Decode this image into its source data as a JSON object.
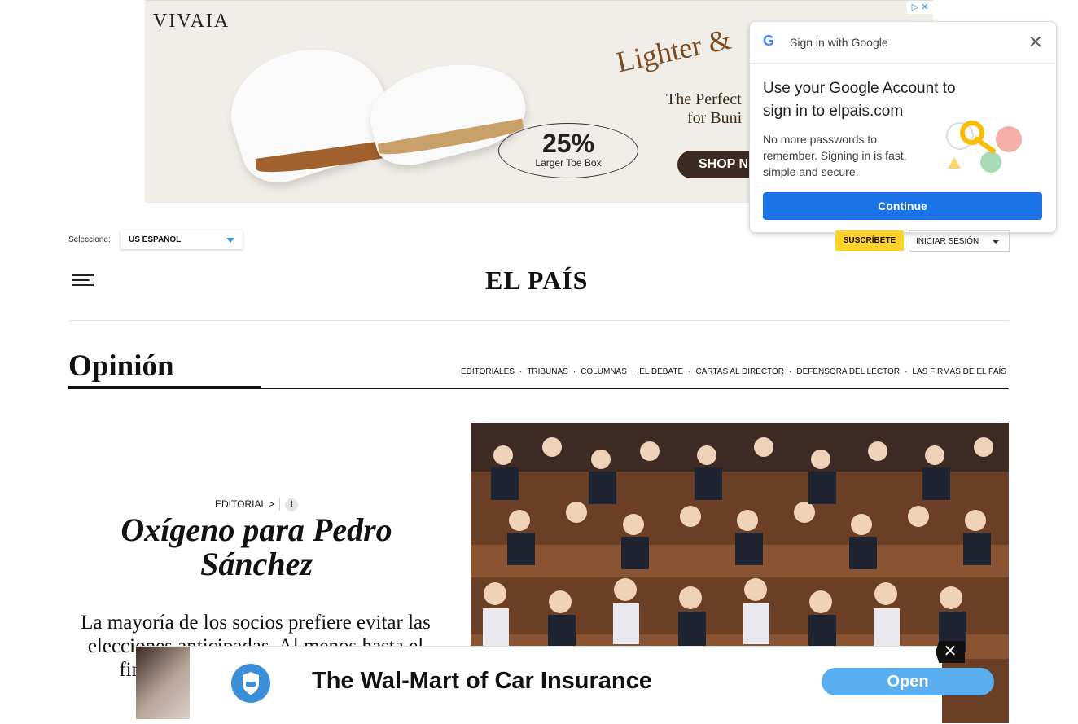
{
  "top_ad": {
    "brand": "VIVAIA",
    "headline": "Lighter &",
    "line1": "The Perfect",
    "line2": "for Buni",
    "badge_pct": "25%",
    "badge_sub": "Larger Toe Box",
    "cta": "SHOP N",
    "adchoices": "▷ ✕"
  },
  "google_popup": {
    "logo": "G",
    "header": "Sign in with Google",
    "close": "✕",
    "title": "Use your Google Account to sign in to elpais.com",
    "body": "No more passwords to remember. Signing in is fast, simple and secure.",
    "continue": "Continue"
  },
  "header": {
    "select_label": "Seleccione:",
    "edition": "US ESPAÑOL",
    "subscribe": "SUSCRÍBETE",
    "login": "INICIAR SESIÓN",
    "logo": "EL PAÍS"
  },
  "section": {
    "title": "Opinión",
    "nav": [
      "EDITORIALES",
      "TRIBUNAS",
      "COLUMNAS",
      "EL DEBATE",
      "CARTAS AL DIRECTOR",
      "DEFENSORA DEL LECTOR",
      "LAS FIRMAS DE EL PAÍS"
    ]
  },
  "article": {
    "kicker": "EDITORIAL >",
    "info": "i",
    "headline": "Oxígeno para Pedro Sánchez",
    "standfirst": "La mayoría de los socios prefiere evitar las elecciones anticipadas. Al menos hasta el final de la legislatura al Gobierno"
  },
  "bottom_ad": {
    "headline": "The Wal-Mart of Car Insurance",
    "cta": "Open",
    "close": "✕"
  }
}
